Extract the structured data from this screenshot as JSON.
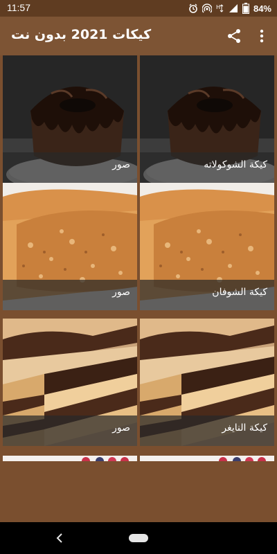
{
  "status_bar": {
    "time": "11:57",
    "battery_percent": "84%"
  },
  "app_bar": {
    "title": "كيكات 2021 بدون نت",
    "share_icon": "share-icon",
    "menu_icon": "more-vert-icon"
  },
  "grid": {
    "rows": [
      {
        "left_caption": "صور",
        "right_caption": "كيكة الشوكولاته",
        "image": "chocolate-bundt-cake"
      },
      {
        "left_caption": "صور",
        "right_caption": "كيكة الشوفان",
        "image": "oat-cake"
      },
      {
        "left_caption": "صور",
        "right_caption": "كيكة النايغر",
        "image": "marble-tiger-cake"
      }
    ]
  },
  "nav_bar": {
    "back_icon": "back-icon",
    "home_icon": "home-pill-icon"
  }
}
